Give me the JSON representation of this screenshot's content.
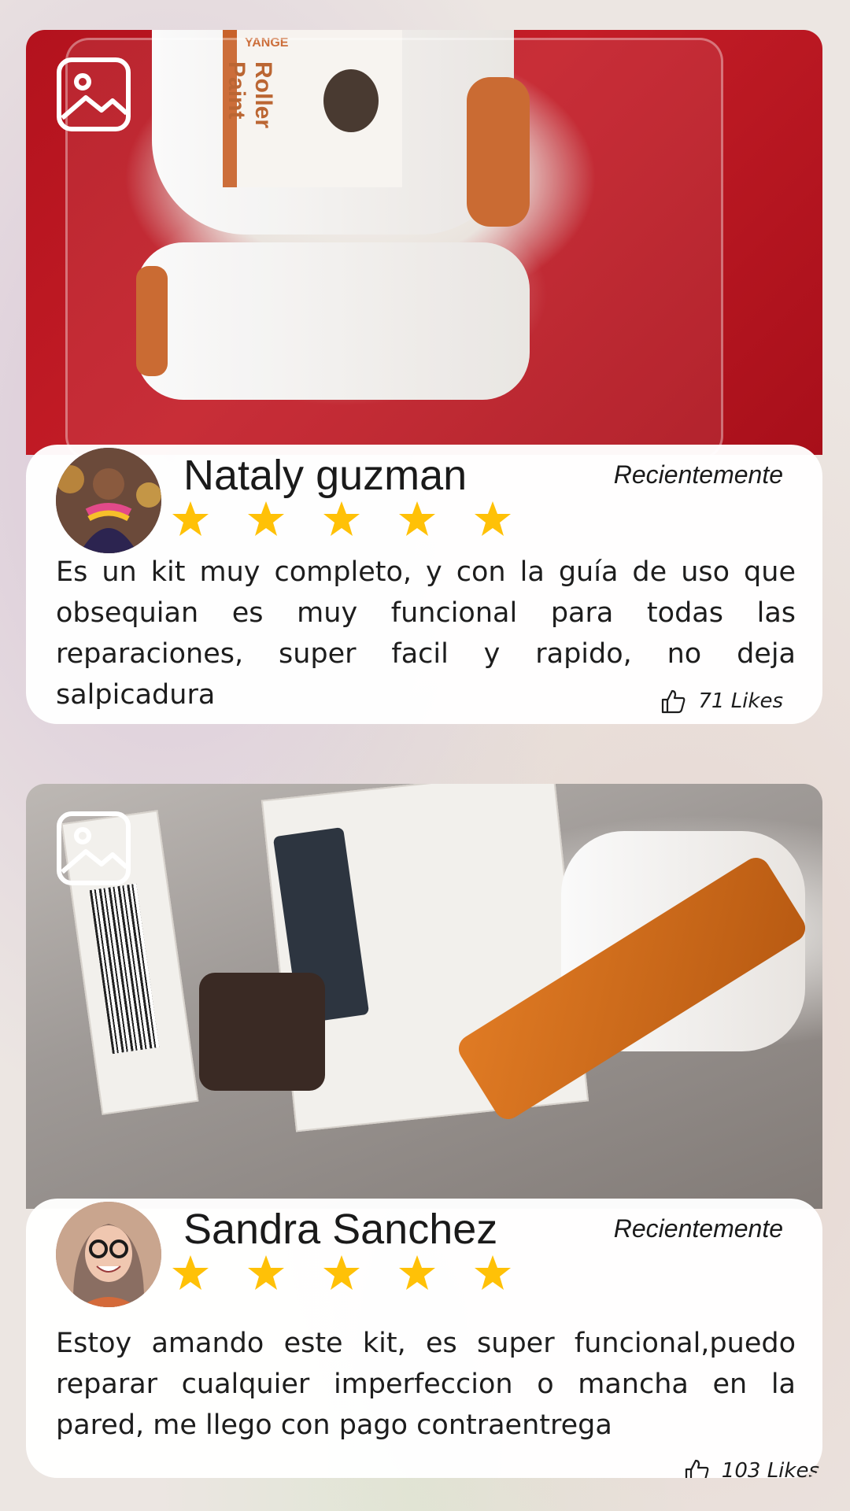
{
  "reviews": [
    {
      "name": "Nataly guzman",
      "time": "Recientemente",
      "rating": 5,
      "text": "Es un kit muy completo, y con la guía de uso que obsequian es muy funcional para todas las reparaciones, super facil y rapido, no deja salpicadura",
      "likes": "71  Likes",
      "photo_text": "Roller Paint",
      "photo_brand": "YANGE"
    },
    {
      "name": "Sandra Sanchez",
      "time": "Recientemente",
      "rating": 5,
      "text": " Estoy amando este kit, es super funcional,puedo reparar cualquier imperfeccion o mancha en la pared, me llego con pago contraentrega",
      "likes": "103  Likes"
    }
  ],
  "icons": {
    "image": "image-icon",
    "star": "star-icon",
    "like": "thumbs-up-icon"
  },
  "colors": {
    "star": "#FFC107",
    "text": "#1a1a1a"
  }
}
